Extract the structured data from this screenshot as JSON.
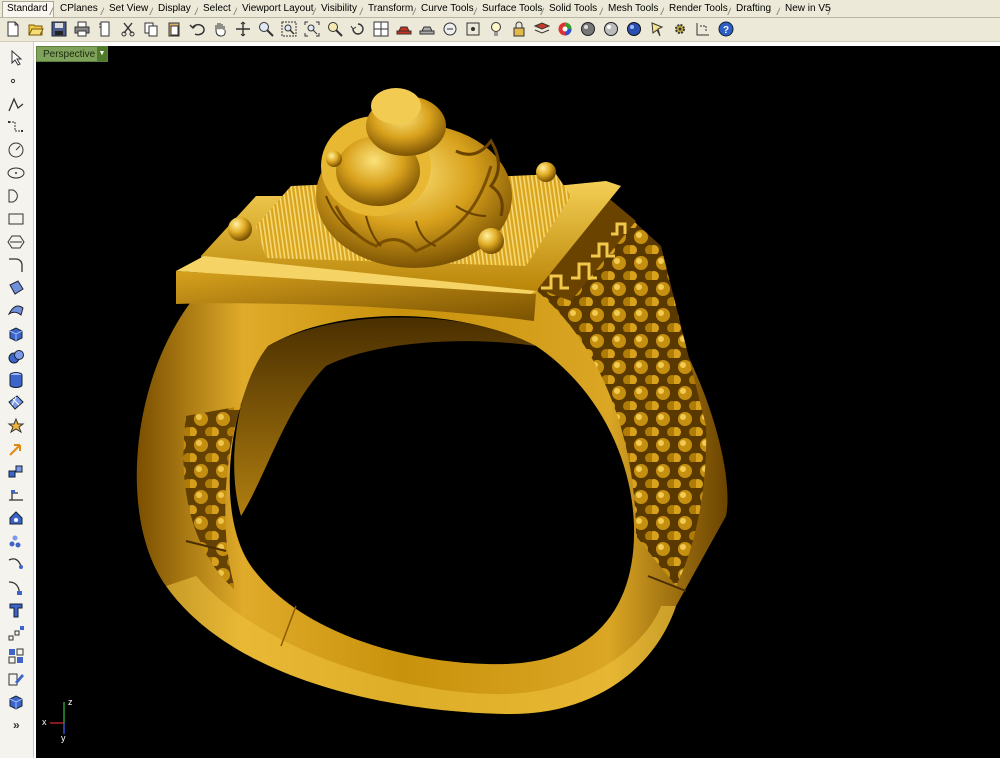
{
  "tabs": [
    {
      "label": "Standard",
      "active": true
    },
    {
      "label": "CPlanes"
    },
    {
      "label": "Set View"
    },
    {
      "label": "Display"
    },
    {
      "label": "Select"
    },
    {
      "label": "Viewport Layout"
    },
    {
      "label": "Visibility"
    },
    {
      "label": "Transform"
    },
    {
      "label": "Curve Tools"
    },
    {
      "label": "Surface Tools"
    },
    {
      "label": "Solid Tools"
    },
    {
      "label": "Mesh Tools"
    },
    {
      "label": "Render Tools"
    },
    {
      "label": "Drafting"
    },
    {
      "label": "New in V5"
    }
  ],
  "viewport": {
    "title": "Perspective",
    "background": "#000000",
    "axes": {
      "x": "x",
      "y": "y",
      "z": "z"
    }
  },
  "sidebar": {
    "more_label": "»"
  },
  "colors": {
    "gold_light": "#f2c84b",
    "gold_mid": "#c8940f",
    "gold_dark": "#6a4300",
    "viewport_tab": "#7fa35a"
  }
}
